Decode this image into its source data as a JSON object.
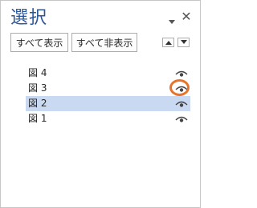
{
  "pane": {
    "title": "選択",
    "close_glyph": "✕"
  },
  "toolbar": {
    "show_all_label": "すべて表示",
    "hide_all_label": "すべて非表示",
    "bring_forward_icon": "triangle-up-icon",
    "send_backward_icon": "triangle-down-icon"
  },
  "items": [
    {
      "label": "図 4",
      "visible": true,
      "selected": false
    },
    {
      "label": "図 3",
      "visible": true,
      "selected": false
    },
    {
      "label": "図 2",
      "visible": true,
      "selected": true
    },
    {
      "label": "図 1",
      "visible": true,
      "selected": false
    }
  ],
  "annotation": {
    "highlight_color": "#e8742c"
  },
  "colors": {
    "title": "#2b579a",
    "selection": "#c9d9f1"
  }
}
